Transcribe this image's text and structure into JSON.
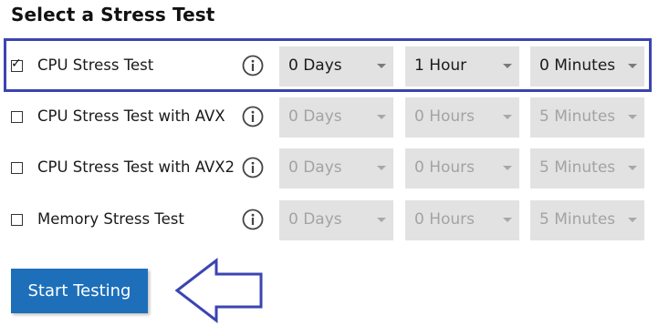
{
  "title": "Select a Stress Test",
  "tests": [
    {
      "name": "CPU Stress Test",
      "checked": true,
      "checkmark": "✓",
      "days": "0 Days",
      "hours": "1 Hour",
      "minutes": "0 Minutes"
    },
    {
      "name": "CPU Stress Test with AVX",
      "checked": false,
      "checkmark": "",
      "days": "0 Days",
      "hours": "0 Hours",
      "minutes": "5 Minutes"
    },
    {
      "name": "CPU Stress Test with AVX2",
      "checked": false,
      "checkmark": "",
      "days": "0 Days",
      "hours": "0 Hours",
      "minutes": "5 Minutes"
    },
    {
      "name": "Memory Stress Test",
      "checked": false,
      "checkmark": "",
      "days": "0 Days",
      "hours": "0 Hours",
      "minutes": "5 Minutes"
    }
  ],
  "start_button": {
    "label": "Start Testing"
  },
  "colors": {
    "accent": "#1d6fba",
    "highlight": "#3a45b2",
    "select_bg": "#e2e2e2"
  },
  "icons": {
    "info": "info-icon",
    "arrow": "arrow-left-icon",
    "dropdown": "chevron-down-icon"
  }
}
